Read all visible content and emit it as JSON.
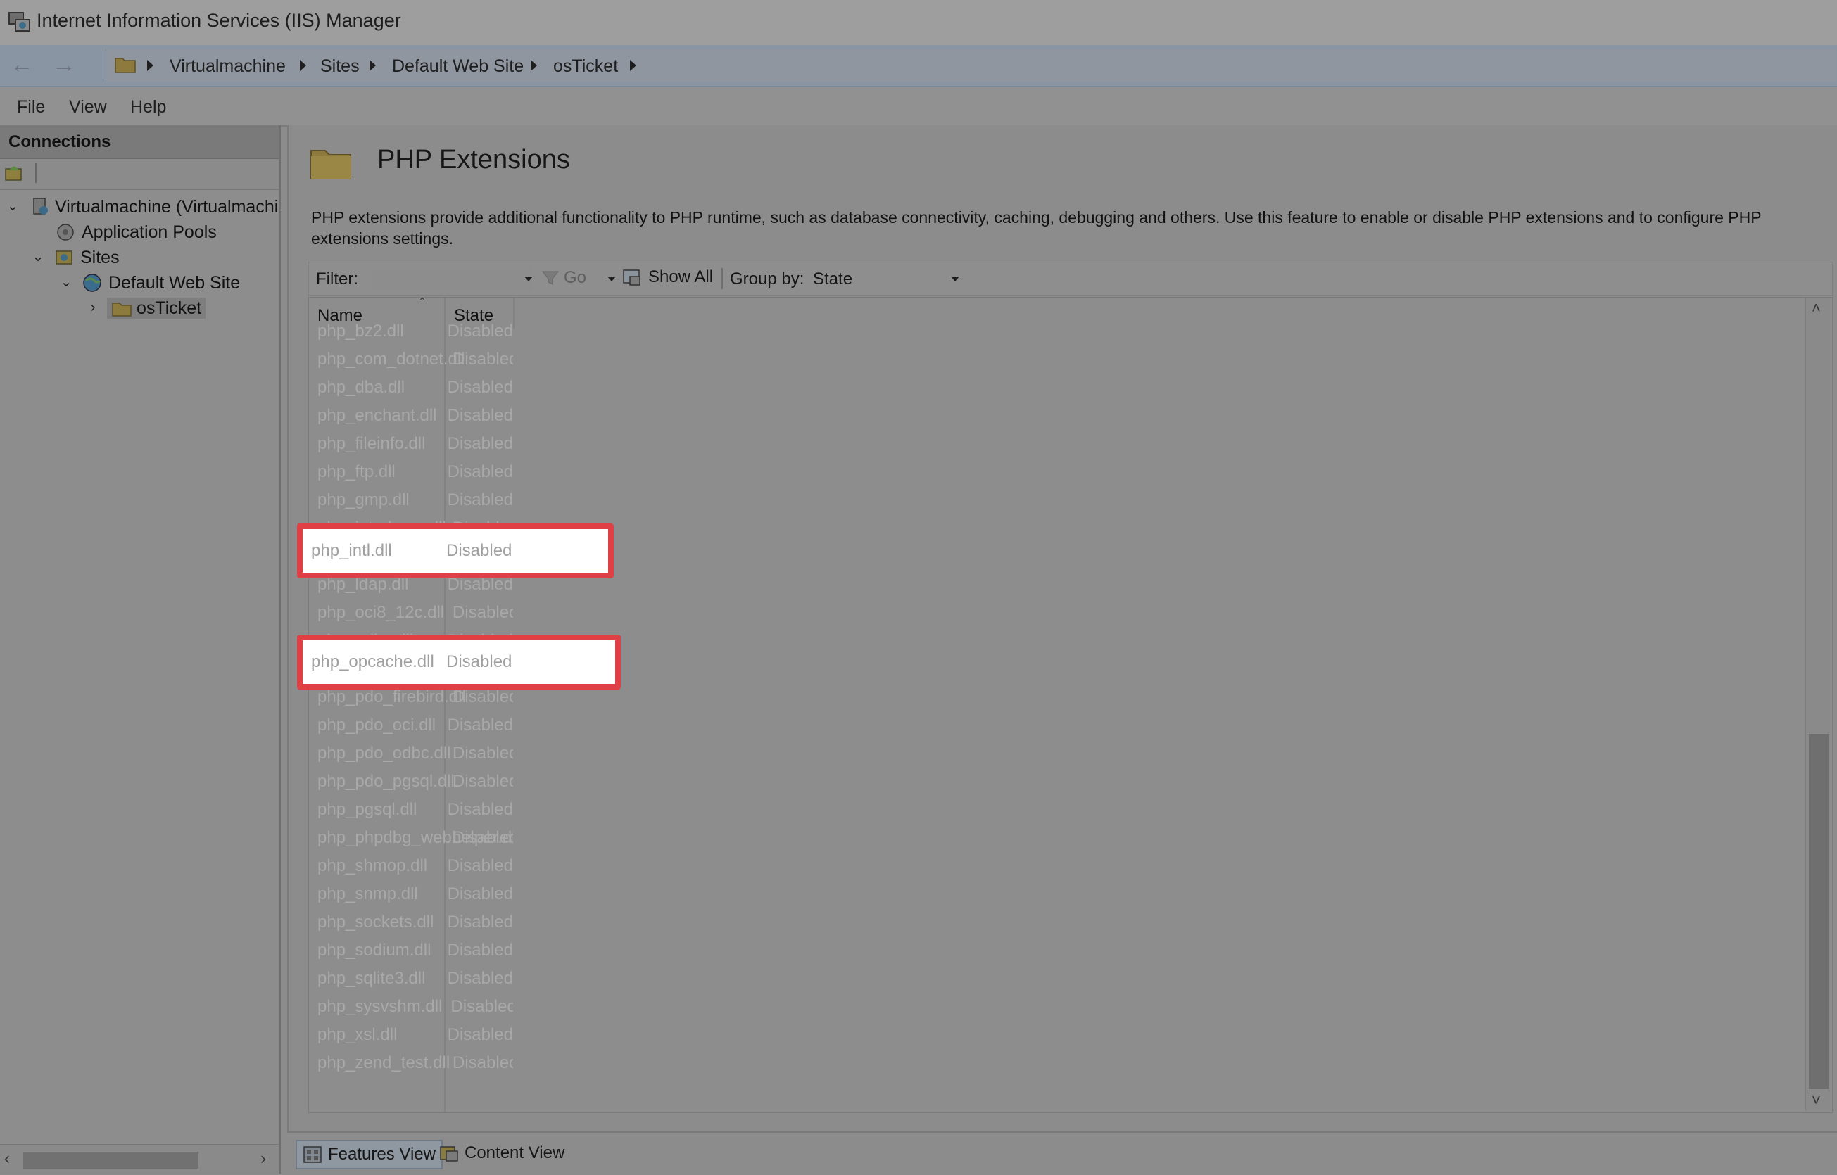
{
  "window": {
    "title": "Internet Information Services (IIS) Manager"
  },
  "address": {
    "breadcrumbs": [
      "Virtualmachine",
      "Sites",
      "Default Web Site",
      "osTicket"
    ]
  },
  "menu": {
    "items": [
      "File",
      "View",
      "Help"
    ]
  },
  "connections": {
    "title": "Connections",
    "tree": [
      {
        "label": "Virtualmachine (Virtualmachi",
        "icon": "server-icon"
      },
      {
        "label": "Application Pools",
        "icon": "app-pools-icon"
      },
      {
        "label": "Sites",
        "icon": "sites-icon"
      },
      {
        "label": "Default Web Site",
        "icon": "globe-icon"
      },
      {
        "label": "osTicket",
        "icon": "folder-icon"
      }
    ]
  },
  "feature": {
    "title": "PHP Extensions",
    "description": "PHP extensions provide additional functionality to PHP runtime, such as database connectivity, caching, debugging and others. Use this feature to enable or disable PHP extensions and to configure PHP extensions settings."
  },
  "filterbar": {
    "filter_label": "Filter:",
    "filter_value": "",
    "go_label": "Go",
    "show_all_label": "Show All",
    "group_by_label": "Group by:",
    "group_by_value": "State"
  },
  "list": {
    "columns": [
      "Name",
      "State"
    ],
    "rows": [
      {
        "name": "php_bz2.dll",
        "state": "Disabled"
      },
      {
        "name": "php_com_dotnet.dll",
        "state": "Disabled"
      },
      {
        "name": "php_dba.dll",
        "state": "Disabled"
      },
      {
        "name": "php_enchant.dll",
        "state": "Disabled"
      },
      {
        "name": "php_fileinfo.dll",
        "state": "Disabled"
      },
      {
        "name": "php_ftp.dll",
        "state": "Disabled"
      },
      {
        "name": "php_gmp.dll",
        "state": "Disabled"
      },
      {
        "name": "php_interbase.dll",
        "state": "Disabled"
      },
      {
        "name": "php_intl.dll",
        "state": "Disabled"
      },
      {
        "name": "php_ldap.dll",
        "state": "Disabled"
      },
      {
        "name": "php_oci8_12c.dll",
        "state": "Disabled"
      },
      {
        "name": "php_odbc.dll",
        "state": "Disabled"
      },
      {
        "name": "php_opcache.dll",
        "state": "Disabled"
      },
      {
        "name": "php_pdo_firebird.dll",
        "state": "Disabled"
      },
      {
        "name": "php_pdo_oci.dll",
        "state": "Disabled"
      },
      {
        "name": "php_pdo_odbc.dll",
        "state": "Disabled"
      },
      {
        "name": "php_pdo_pgsql.dll",
        "state": "Disabled"
      },
      {
        "name": "php_pgsql.dll",
        "state": "Disabled"
      },
      {
        "name": "php_phpdbg_webhelper.dll",
        "state": "Disabled"
      },
      {
        "name": "php_shmop.dll",
        "state": "Disabled"
      },
      {
        "name": "php_snmp.dll",
        "state": "Disabled"
      },
      {
        "name": "php_sockets.dll",
        "state": "Disabled"
      },
      {
        "name": "php_sodium.dll",
        "state": "Disabled"
      },
      {
        "name": "php_sqlite3.dll",
        "state": "Disabled"
      },
      {
        "name": "php_sysvshm.dll",
        "state": "Disabled"
      },
      {
        "name": "php_xsl.dll",
        "state": "Disabled"
      },
      {
        "name": "php_zend_test.dll",
        "state": "Disabled"
      }
    ],
    "highlighted": [
      {
        "name": "php_intl.dll",
        "state": "Disabled"
      },
      {
        "name": "php_opcache.dll",
        "state": "Disabled"
      }
    ]
  },
  "bottom_tabs": {
    "features_view": "Features View",
    "content_view": "Content View"
  },
  "colors": {
    "highlight_border": "#e03f45",
    "overlay_gray": "#8c8c8c"
  }
}
